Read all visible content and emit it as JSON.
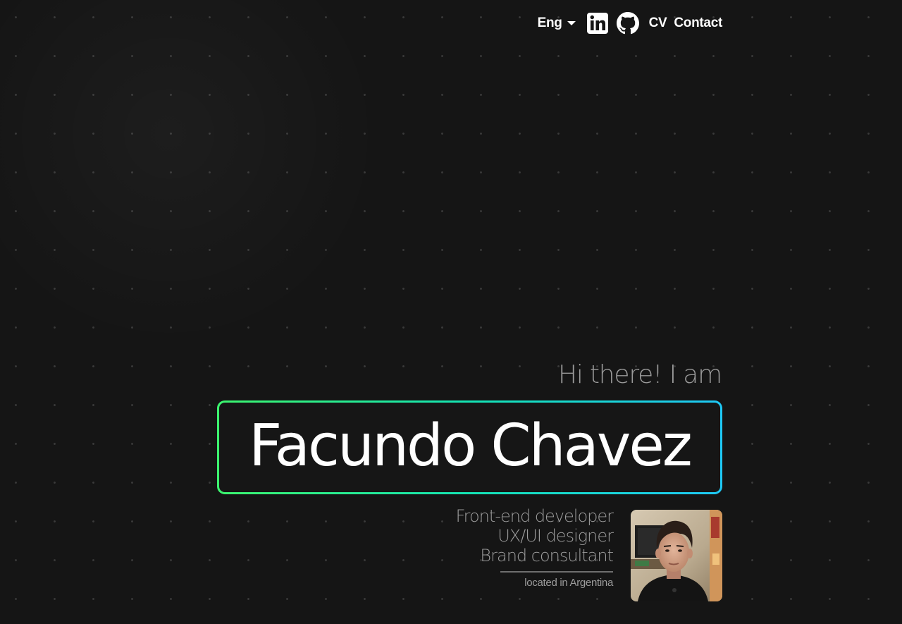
{
  "nav": {
    "language": "Eng",
    "linkedin_icon": "linkedin-icon",
    "github_icon": "github-icon",
    "cv_label": "CV",
    "contact_label": "Contact"
  },
  "hero": {
    "greeting": "Hi there! I am",
    "name": "Facundo Chavez",
    "roles": [
      "Front-end developer",
      "UX/UI designer",
      "Brand consultant"
    ],
    "location": "located in Argentina"
  },
  "colors": {
    "background": "#151515",
    "dots": "#3a3a3a",
    "gradient_start": "#3cf56e",
    "gradient_end": "#1ec8f5",
    "muted_text": "#9a9a9a",
    "text": "#ffffff"
  }
}
